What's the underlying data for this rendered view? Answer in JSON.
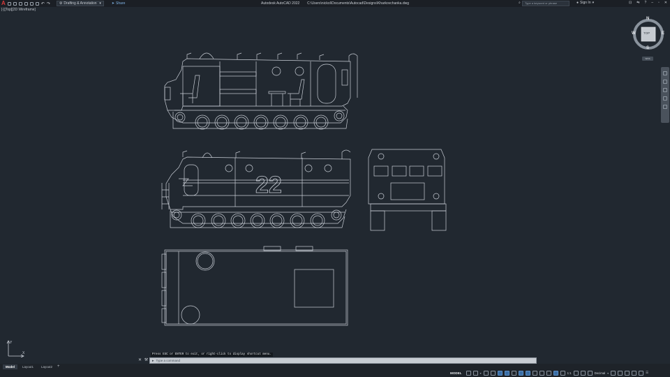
{
  "titlebar": {
    "logo": "A",
    "workspace": "Drafting & Annotation",
    "share_label": "Share",
    "app_name": "Autodesk AutoCAD 2022",
    "file_path": "C:\\Users\\nickol\\Documents\\Autocad\\Designs\\Kharkovchanka.dwg",
    "search_placeholder": "Type a keyword or phrase",
    "signin_label": "Sign In"
  },
  "viewport": {
    "label": "[-][Top][2D Wireframe]"
  },
  "viewcube": {
    "face": "TOP",
    "north": "N",
    "south": "S",
    "east": "E",
    "west": "W",
    "wcs_label": "WCS"
  },
  "drawing": {
    "vehicle_number": "22"
  },
  "command": {
    "history": "Press ESC or ENTER to exit, or right-click to display shortcut menu.",
    "placeholder": "Type a command"
  },
  "tabs": [
    {
      "label": "Model",
      "active": true
    },
    {
      "label": "Layout1",
      "active": false
    },
    {
      "label": "Layout2",
      "active": false
    }
  ],
  "status": {
    "mode": "MODEL",
    "scale": "1:1",
    "units": "Decimal"
  },
  "colors": {
    "background": "#212830",
    "linework": "#c9ced6",
    "accent": "#3a6ea5",
    "logo": "#d63a3a"
  }
}
